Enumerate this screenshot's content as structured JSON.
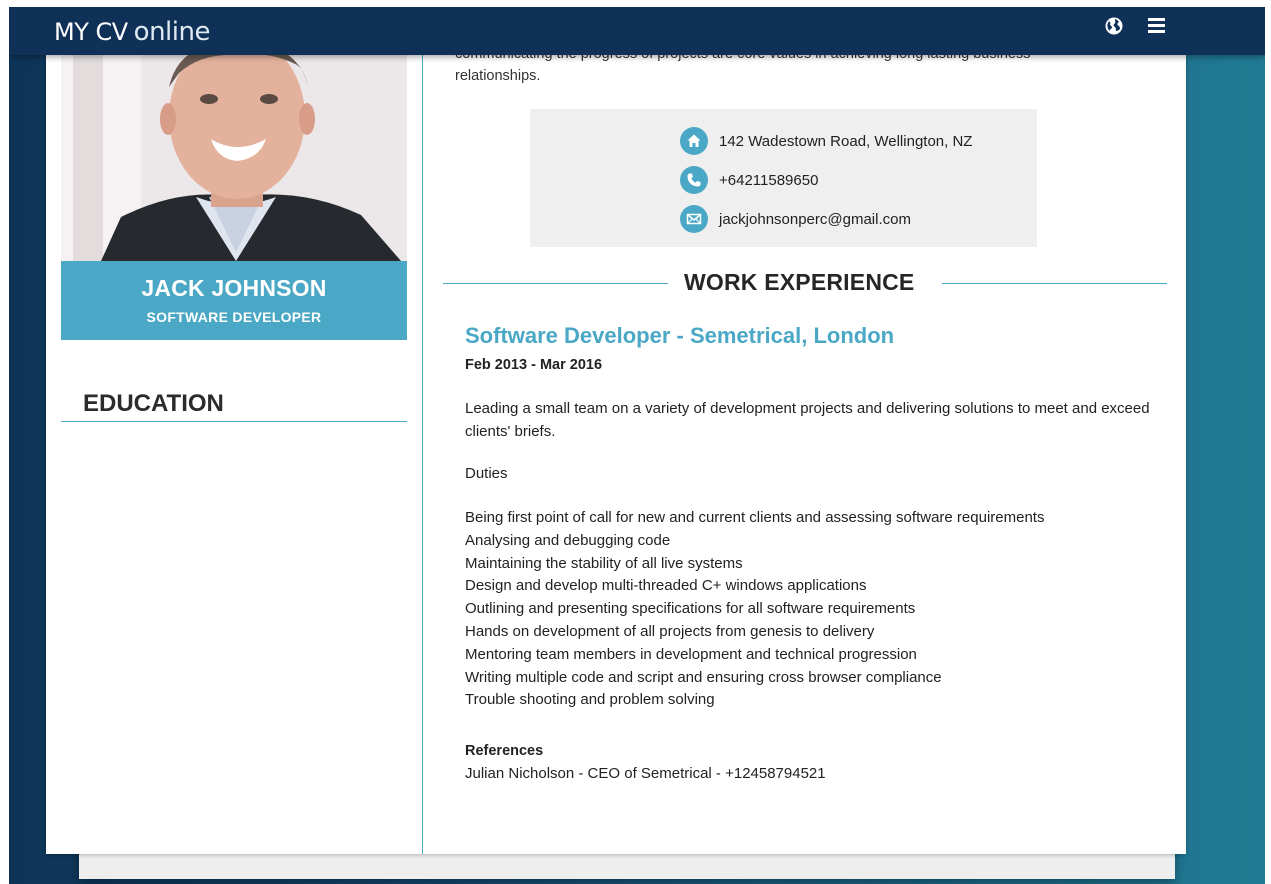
{
  "topbar": {
    "logo_part1": "MY CV",
    "logo_part2": "online"
  },
  "profile": {
    "name": "JACK JOHNSON",
    "role": "SOFTWARE DEVELOPER"
  },
  "left": {
    "education_title": "EDUCATION"
  },
  "intro_cutoff": {
    "line1": "communicating the progress of projects are core values in achieving long lasting business",
    "line2": "relationships."
  },
  "contact": {
    "address": "142 Wadestown Road, Wellington, NZ",
    "phone": "+64211589650",
    "email": "jackjohnsonperc@gmail.com"
  },
  "work": {
    "section_title": "WORK EXPERIENCE",
    "job_title": "Software Developer - Semetrical, London",
    "dates": "Feb 2013 - Mar 2016",
    "description": "Leading a small team on a variety of development projects and delivering solutions to meet and exceed clients' briefs.",
    "duties_label": "Duties",
    "duties": [
      "Being first point of call for new and current clients and assessing software requirements",
      "Analysing and debugging code",
      "Maintaining the stability of all live systems",
      "Design and develop multi-threaded C+ windows applications",
      "Outlining and presenting specifications for all software requirements",
      "Hands on development of all projects from genesis to delivery",
      "Mentoring team members in development and technical progression",
      "Writing multiple code and script and ensuring cross browser compliance",
      "Trouble shooting and problem solving"
    ],
    "references_label": "References",
    "reference": "Julian Nicholson - CEO of Semetrical - +12458794521"
  },
  "colors": {
    "accent": "#4aa8c6",
    "topbar": "#0f3158"
  }
}
